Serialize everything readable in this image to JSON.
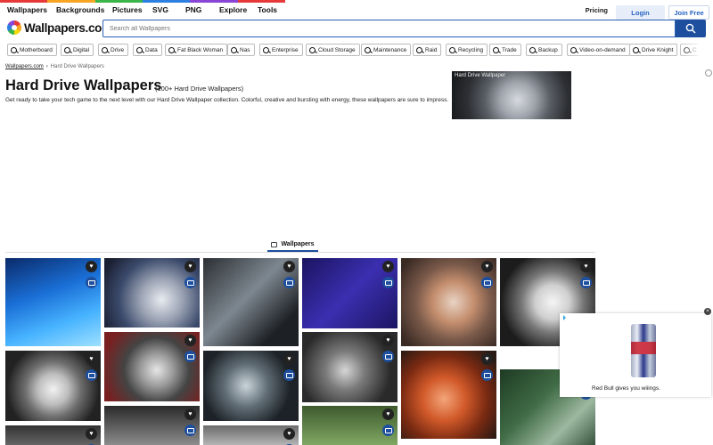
{
  "colors": {
    "rainbow": [
      "#e63a3a",
      "#f6a623",
      "#3ab54a",
      "#2d7fe0",
      "#8b45d6",
      "#e63a3a"
    ],
    "accent": "#1d4f9e"
  },
  "nav": {
    "items": [
      {
        "label": "Wallpapers"
      },
      {
        "label": "Backgrounds"
      },
      {
        "label": "Pictures"
      },
      {
        "label": "SVG"
      },
      {
        "label": "PNG"
      },
      {
        "label": "Explore"
      },
      {
        "label": "Tools"
      }
    ],
    "pricing": "Pricing",
    "login": "Login",
    "join": "Join Free"
  },
  "logo": {
    "text": "Wallpapers.com",
    "icon": "wheel-logo-icon"
  },
  "search": {
    "placeholder": "Search all Wallpapers",
    "icon": "search-icon"
  },
  "tags": [
    "Motherboard",
    "Digital",
    "Drive",
    "Data",
    "Fat Black Woman",
    "Nas",
    "Enterprise",
    "Cloud Storage",
    "Maintenance",
    "Raid",
    "Recycling",
    "Trade",
    "Backup",
    "Video-on-demand",
    "Drive Knight",
    "C"
  ],
  "breadcrumb": {
    "home": "Wallpapers.com",
    "separator": "›",
    "current": "Hard Drive Wallpapers"
  },
  "page": {
    "title": "Hard Drive Wallpapers",
    "count": "(100+ Hard Drive Wallpapers)",
    "description": "Get ready to take your tech game to the next level with our Hard Drive Wallpaper collection. Colorful, creative and bursting with energy, these wallpapers are sure to impress.",
    "hero_label": "Hard Drive Wallpaper"
  },
  "tab": {
    "label": "Wallpapers",
    "icon": "image-icon"
  },
  "ad": {
    "text": "Red Bull gives you wiiings.",
    "close": "×"
  }
}
